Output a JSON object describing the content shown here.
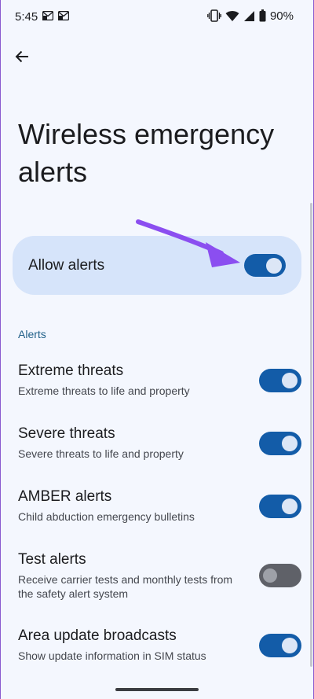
{
  "status_bar": {
    "time": "5:45",
    "battery_percent": "90%"
  },
  "header": {
    "title": "Wireless emergency alerts"
  },
  "allow_alerts": {
    "label": "Allow alerts",
    "enabled": true
  },
  "alerts_section": {
    "header": "Alerts",
    "items": [
      {
        "title": "Extreme threats",
        "subtitle": "Extreme threats to life and property",
        "enabled": true
      },
      {
        "title": "Severe threats",
        "subtitle": "Severe threats to life and property",
        "enabled": true
      },
      {
        "title": "AMBER alerts",
        "subtitle": "Child abduction emergency bulletins",
        "enabled": true
      },
      {
        "title": "Test alerts",
        "subtitle": "Receive carrier tests and monthly tests from the safety alert system",
        "enabled": false
      },
      {
        "title": "Area update broadcasts",
        "subtitle": "Show update information in SIM status",
        "enabled": true
      }
    ]
  },
  "colors": {
    "background": "#f4f7fe",
    "card": "#d6e4fa",
    "switch_on": "#135ca8",
    "switch_off": "#5f6168",
    "section_header": "#1f5f88",
    "annotation_arrow": "#8b4ef0"
  },
  "icons": {
    "back": "arrow-left-icon",
    "notifications": [
      "gmail-notification-icon",
      "gmail-notification-icon"
    ],
    "vibrate": "vibrate-icon",
    "wifi": "wifi-icon",
    "signal": "cell-signal-icon",
    "battery": "battery-icon"
  }
}
